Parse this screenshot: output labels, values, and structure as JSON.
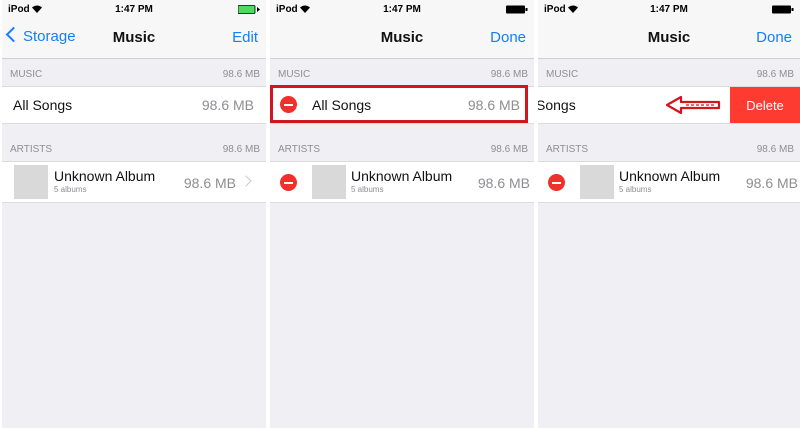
{
  "status": {
    "carrier": "iPod",
    "time": "1:47 PM"
  },
  "colors": {
    "accent": "#147efb",
    "delete": "#fe3b30",
    "minus": "#f0302b",
    "highlight": "#d3151e",
    "battery_charging": "#4cd964"
  },
  "screens": [
    {
      "nav": {
        "back": "Storage",
        "title": "Music",
        "right": "Edit"
      },
      "music_header": {
        "label": "MUSIC",
        "size": "98.6 MB"
      },
      "all_songs": {
        "label": "All Songs",
        "size": "98.6 MB"
      },
      "artists_header": {
        "label": "ARTISTS",
        "size": "98.6 MB"
      },
      "album": {
        "title": "Unknown Album",
        "subtitle": "5 albums",
        "size": "98.6 MB"
      }
    },
    {
      "nav": {
        "title": "Music",
        "right": "Done"
      },
      "music_header": {
        "label": "MUSIC",
        "size": "98.6 MB"
      },
      "all_songs": {
        "label": "All Songs",
        "size": "98.6 MB"
      },
      "artists_header": {
        "label": "ARTISTS",
        "size": "98.6 MB"
      },
      "album": {
        "title": "Unknown Album",
        "subtitle": "5 albums",
        "size": "98.6 MB"
      }
    },
    {
      "nav": {
        "title": "Music",
        "right": "Done"
      },
      "music_header": {
        "label": "MUSIC",
        "size": "98.6 MB"
      },
      "all_songs": {
        "label": "Songs",
        "delete": "Delete"
      },
      "artists_header": {
        "label": "ARTISTS",
        "size": "98.6 MB"
      },
      "album": {
        "title": "Unknown Album",
        "subtitle": "5 albums",
        "size": "98.6 MB"
      }
    }
  ],
  "icons": [
    "wifi-icon",
    "battery-icon",
    "chevron-left-icon",
    "chevron-right-icon",
    "minus-circle-icon",
    "swipe-left-arrow-icon"
  ]
}
